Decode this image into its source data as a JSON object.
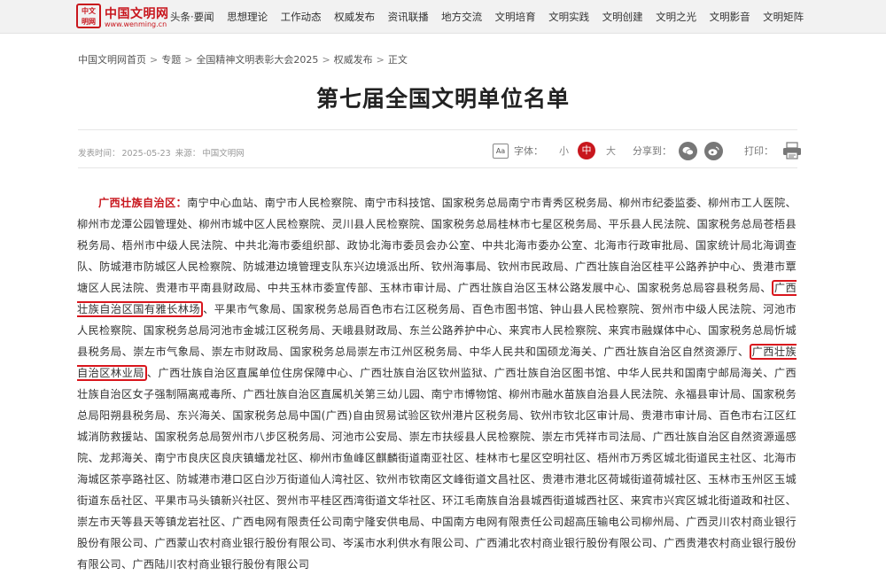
{
  "site": {
    "logo_seal": "中文\n明网",
    "logo_name": "中国文明网",
    "logo_url": "www.wenming.cn"
  },
  "nav": [
    "头条·要闻",
    "思想理论",
    "工作动态",
    "权威发布",
    "资讯联播",
    "地方交流",
    "文明培育",
    "文明实践",
    "文明创建",
    "文明之光",
    "文明影音",
    "文明矩阵"
  ],
  "breadcrumb": [
    "中国文明网首页",
    "专题",
    "全国精神文明表彰大会2025",
    "权威发布",
    "正文"
  ],
  "breadcrumb_sep": ">",
  "article": {
    "title": "第七届全国文明单位名单",
    "meta": {
      "time_label": "发表时间：",
      "time": "2025-05-23",
      "source_label": "来源：",
      "source": "中国文明网"
    },
    "font_label": "字体：",
    "font_icon_text": "Aa",
    "font_small": "小",
    "font_medium": "中",
    "font_large": "大",
    "share_label": "分享到：",
    "print_label": "打印：",
    "province": "广西壮族自治区：",
    "segments": [
      {
        "text": "南宁中心血站、南宁市人民检察院、南宁市科技馆、国家税务总局南宁市青秀区税务局、柳州市纪委监委、柳州市工人医院、柳州市龙潭公园管理处、柳州市城中区人民检察院、灵川县人民检察院、国家税务总局桂林市七星区税务局、平乐县人民法院、国家税务总局苍梧县税务局、梧州市中级人民法院、中共北海市委组织部、政协北海市委员会办公室、中共北海市委办公室、北海市行政审批局、国家统计局北海调查队、防城港市防城区人民检察院、防城港边境管理支队东兴边境派出所、钦州海事局、钦州市民政局、广西壮族自治区桂平公路养护中心、贵港市覃塘区人民法院、贵港市平南县财政局、中共玉林市委宣传部、玉林市审计局、广西壮族自治区玉林公路发展中心、国家税务总局容县税务局、",
        "hl": false
      },
      {
        "text": "广西壮族自治区国有雅长林场",
        "hl": true
      },
      {
        "text": "、平果市气象局、国家税务总局百色市右江区税务局、百色市图书馆、钟山县人民检察院、贺州市中级人民法院、河池市人民检察院、国家税务总局河池市金城江区税务局、天峨县财政局、东兰公路养护中心、来宾市人民检察院、来宾市融媒体中心、国家税务总局忻城县税务局、崇左市气象局、崇左市财政局、国家税务总局崇左市江州区税务局、中华人民共和国硕龙海关、广西壮族自治区自然资源厅、",
        "hl": false
      },
      {
        "text": "广西壮族自治区林业局",
        "hl": true
      },
      {
        "text": "、广西壮族自治区直属单位住房保障中心、广西壮族自治区钦州监狱、广西壮族自治区图书馆、中华人民共和国南宁邮局海关、广西壮族自治区女子强制隔离戒毒所、广西壮族自治区直属机关第三幼儿园、南宁市博物馆、柳州市融水苗族自治县人民法院、永福县审计局、国家税务总局阳朔县税务局、东兴海关、国家税务总局中国(广西)自由贸易试验区钦州港片区税务局、钦州市钦北区审计局、贵港市审计局、百色市右江区红城消防救援站、国家税务总局贺州市八步区税务局、河池市公安局、崇左市扶绥县人民检察院、崇左市凭祥市司法局、广西壮族自治区自然资源遥感院、龙邦海关、南宁市良庆区良庆镇蟠龙社区、柳州市鱼峰区麒麟街道南亚社区、桂林市七星区空明社区、梧州市万秀区城北街道民主社区、北海市海城区茶亭路社区、防城港市港口区白沙万街道仙人湾社区、钦州市钦南区文峰街道文昌社区、贵港市港北区荷城街道荷城社区、玉林市玉州区玉城街道东岳社区、平果市马头镇新兴社区、贺州市平桂区西湾街道文华社区、环江毛南族自治县城西街道城西社区、来宾市兴宾区城北街道政和社区、崇左市天等县天等镇龙岩社区、广西电网有限责任公司南宁隆安供电局、中国南方电网有限责任公司超高压输电公司柳州局、广西灵川农村商业银行股份有限公司、广西蒙山农村商业银行股份有限公司、岑溪市水利供水有限公司、广西浦北农村商业银行股份有限公司、广西贵港农村商业银行股份有限公司、广西陆川农村商业银行股份有限公司",
        "hl": false
      }
    ]
  },
  "colors": {
    "accent": "#c8161d",
    "highlight_box": "#d9161d",
    "nav_bg": "#f2f2f2"
  },
  "icons": [
    "font-size-icon",
    "wechat-icon",
    "weibo-icon",
    "printer-icon"
  ]
}
